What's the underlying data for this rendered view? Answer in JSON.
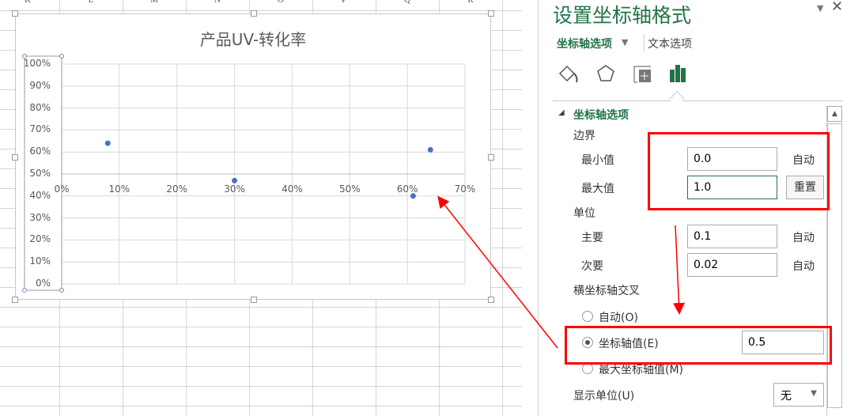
{
  "sheet": {
    "columns": [
      "K",
      "L",
      "M",
      "N",
      "O",
      "P",
      "Q",
      "R"
    ]
  },
  "chart_data": {
    "type": "scatter",
    "title": "产品UV-转化率",
    "x": [
      0.08,
      0.3,
      0.61,
      0.64
    ],
    "y": [
      0.64,
      0.47,
      0.4,
      0.61
    ],
    "xlim": [
      0,
      0.7
    ],
    "ylim": [
      0,
      1.0
    ],
    "x_cross_at": 0.5,
    "xticks": [
      "0%",
      "10%",
      "20%",
      "30%",
      "40%",
      "50%",
      "60%",
      "70%"
    ],
    "yticks": [
      "0%",
      "10%",
      "20%",
      "30%",
      "40%",
      "50%",
      "60%",
      "70%",
      "80%",
      "90%",
      "100%"
    ],
    "marker_color": "#4472c4",
    "grid": true
  },
  "panel": {
    "title": "设置坐标轴格式",
    "tab_axis_options": "坐标轴选项",
    "tab_text_options": "文本选项",
    "icons": [
      "fill-icon",
      "pentagon-effects-icon",
      "size-properties-icon",
      "bar-chart-icon"
    ],
    "section": "坐标轴选项",
    "bounds_label": "边界",
    "min_label": "最小值",
    "min_value": "0.0",
    "min_status": "自动",
    "max_label": "最大值",
    "max_value": "1.0",
    "max_reset": "重置",
    "units_label": "单位",
    "major_label": "主要",
    "major_value": "0.1",
    "major_status": "自动",
    "minor_label": "次要",
    "minor_value": "0.02",
    "minor_status": "自动",
    "cross_label": "横坐标轴交叉",
    "cross_auto": "自动(O)",
    "cross_value_label": "坐标轴值(E)",
    "cross_value": "0.5",
    "cross_max": "最大坐标轴值(M)",
    "display_units_label": "显示单位(U)",
    "display_units_value": "无",
    "accent": "#217346"
  }
}
